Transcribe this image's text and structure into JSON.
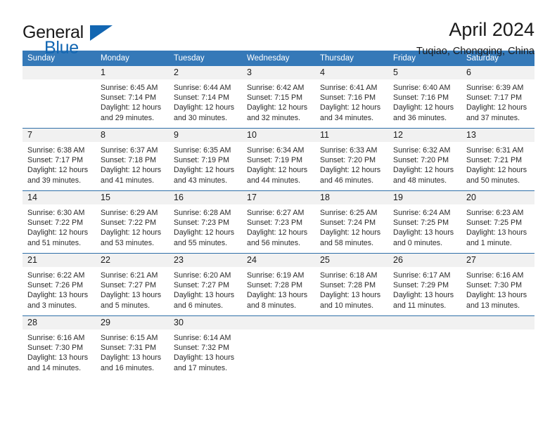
{
  "brand": {
    "name_top": "General",
    "name_bottom": "Blue",
    "accent_color": "#1266b2"
  },
  "header": {
    "title": "April 2024",
    "subtitle": "Tuqiao, Chongqing, China"
  },
  "calendar": {
    "header_bg": "#3579b8",
    "daynum_bg": "#f1f1f1",
    "row_divider_color": "#2f6fa8",
    "weekday_headers": [
      "Sunday",
      "Monday",
      "Tuesday",
      "Wednesday",
      "Thursday",
      "Friday",
      "Saturday"
    ],
    "weeks": [
      [
        {
          "day": "",
          "sunrise": "",
          "sunset": "",
          "daylight_line1": "",
          "daylight_line2": ""
        },
        {
          "day": "1",
          "sunrise": "Sunrise: 6:45 AM",
          "sunset": "Sunset: 7:14 PM",
          "daylight_line1": "Daylight: 12 hours",
          "daylight_line2": "and 29 minutes."
        },
        {
          "day": "2",
          "sunrise": "Sunrise: 6:44 AM",
          "sunset": "Sunset: 7:14 PM",
          "daylight_line1": "Daylight: 12 hours",
          "daylight_line2": "and 30 minutes."
        },
        {
          "day": "3",
          "sunrise": "Sunrise: 6:42 AM",
          "sunset": "Sunset: 7:15 PM",
          "daylight_line1": "Daylight: 12 hours",
          "daylight_line2": "and 32 minutes."
        },
        {
          "day": "4",
          "sunrise": "Sunrise: 6:41 AM",
          "sunset": "Sunset: 7:16 PM",
          "daylight_line1": "Daylight: 12 hours",
          "daylight_line2": "and 34 minutes."
        },
        {
          "day": "5",
          "sunrise": "Sunrise: 6:40 AM",
          "sunset": "Sunset: 7:16 PM",
          "daylight_line1": "Daylight: 12 hours",
          "daylight_line2": "and 36 minutes."
        },
        {
          "day": "6",
          "sunrise": "Sunrise: 6:39 AM",
          "sunset": "Sunset: 7:17 PM",
          "daylight_line1": "Daylight: 12 hours",
          "daylight_line2": "and 37 minutes."
        }
      ],
      [
        {
          "day": "7",
          "sunrise": "Sunrise: 6:38 AM",
          "sunset": "Sunset: 7:17 PM",
          "daylight_line1": "Daylight: 12 hours",
          "daylight_line2": "and 39 minutes."
        },
        {
          "day": "8",
          "sunrise": "Sunrise: 6:37 AM",
          "sunset": "Sunset: 7:18 PM",
          "daylight_line1": "Daylight: 12 hours",
          "daylight_line2": "and 41 minutes."
        },
        {
          "day": "9",
          "sunrise": "Sunrise: 6:35 AM",
          "sunset": "Sunset: 7:19 PM",
          "daylight_line1": "Daylight: 12 hours",
          "daylight_line2": "and 43 minutes."
        },
        {
          "day": "10",
          "sunrise": "Sunrise: 6:34 AM",
          "sunset": "Sunset: 7:19 PM",
          "daylight_line1": "Daylight: 12 hours",
          "daylight_line2": "and 44 minutes."
        },
        {
          "day": "11",
          "sunrise": "Sunrise: 6:33 AM",
          "sunset": "Sunset: 7:20 PM",
          "daylight_line1": "Daylight: 12 hours",
          "daylight_line2": "and 46 minutes."
        },
        {
          "day": "12",
          "sunrise": "Sunrise: 6:32 AM",
          "sunset": "Sunset: 7:20 PM",
          "daylight_line1": "Daylight: 12 hours",
          "daylight_line2": "and 48 minutes."
        },
        {
          "day": "13",
          "sunrise": "Sunrise: 6:31 AM",
          "sunset": "Sunset: 7:21 PM",
          "daylight_line1": "Daylight: 12 hours",
          "daylight_line2": "and 50 minutes."
        }
      ],
      [
        {
          "day": "14",
          "sunrise": "Sunrise: 6:30 AM",
          "sunset": "Sunset: 7:22 PM",
          "daylight_line1": "Daylight: 12 hours",
          "daylight_line2": "and 51 minutes."
        },
        {
          "day": "15",
          "sunrise": "Sunrise: 6:29 AM",
          "sunset": "Sunset: 7:22 PM",
          "daylight_line1": "Daylight: 12 hours",
          "daylight_line2": "and 53 minutes."
        },
        {
          "day": "16",
          "sunrise": "Sunrise: 6:28 AM",
          "sunset": "Sunset: 7:23 PM",
          "daylight_line1": "Daylight: 12 hours",
          "daylight_line2": "and 55 minutes."
        },
        {
          "day": "17",
          "sunrise": "Sunrise: 6:27 AM",
          "sunset": "Sunset: 7:23 PM",
          "daylight_line1": "Daylight: 12 hours",
          "daylight_line2": "and 56 minutes."
        },
        {
          "day": "18",
          "sunrise": "Sunrise: 6:25 AM",
          "sunset": "Sunset: 7:24 PM",
          "daylight_line1": "Daylight: 12 hours",
          "daylight_line2": "and 58 minutes."
        },
        {
          "day": "19",
          "sunrise": "Sunrise: 6:24 AM",
          "sunset": "Sunset: 7:25 PM",
          "daylight_line1": "Daylight: 13 hours",
          "daylight_line2": "and 0 minutes."
        },
        {
          "day": "20",
          "sunrise": "Sunrise: 6:23 AM",
          "sunset": "Sunset: 7:25 PM",
          "daylight_line1": "Daylight: 13 hours",
          "daylight_line2": "and 1 minute."
        }
      ],
      [
        {
          "day": "21",
          "sunrise": "Sunrise: 6:22 AM",
          "sunset": "Sunset: 7:26 PM",
          "daylight_line1": "Daylight: 13 hours",
          "daylight_line2": "and 3 minutes."
        },
        {
          "day": "22",
          "sunrise": "Sunrise: 6:21 AM",
          "sunset": "Sunset: 7:27 PM",
          "daylight_line1": "Daylight: 13 hours",
          "daylight_line2": "and 5 minutes."
        },
        {
          "day": "23",
          "sunrise": "Sunrise: 6:20 AM",
          "sunset": "Sunset: 7:27 PM",
          "daylight_line1": "Daylight: 13 hours",
          "daylight_line2": "and 6 minutes."
        },
        {
          "day": "24",
          "sunrise": "Sunrise: 6:19 AM",
          "sunset": "Sunset: 7:28 PM",
          "daylight_line1": "Daylight: 13 hours",
          "daylight_line2": "and 8 minutes."
        },
        {
          "day": "25",
          "sunrise": "Sunrise: 6:18 AM",
          "sunset": "Sunset: 7:28 PM",
          "daylight_line1": "Daylight: 13 hours",
          "daylight_line2": "and 10 minutes."
        },
        {
          "day": "26",
          "sunrise": "Sunrise: 6:17 AM",
          "sunset": "Sunset: 7:29 PM",
          "daylight_line1": "Daylight: 13 hours",
          "daylight_line2": "and 11 minutes."
        },
        {
          "day": "27",
          "sunrise": "Sunrise: 6:16 AM",
          "sunset": "Sunset: 7:30 PM",
          "daylight_line1": "Daylight: 13 hours",
          "daylight_line2": "and 13 minutes."
        }
      ],
      [
        {
          "day": "28",
          "sunrise": "Sunrise: 6:16 AM",
          "sunset": "Sunset: 7:30 PM",
          "daylight_line1": "Daylight: 13 hours",
          "daylight_line2": "and 14 minutes."
        },
        {
          "day": "29",
          "sunrise": "Sunrise: 6:15 AM",
          "sunset": "Sunset: 7:31 PM",
          "daylight_line1": "Daylight: 13 hours",
          "daylight_line2": "and 16 minutes."
        },
        {
          "day": "30",
          "sunrise": "Sunrise: 6:14 AM",
          "sunset": "Sunset: 7:32 PM",
          "daylight_line1": "Daylight: 13 hours",
          "daylight_line2": "and 17 minutes."
        },
        {
          "day": "",
          "sunrise": "",
          "sunset": "",
          "daylight_line1": "",
          "daylight_line2": ""
        },
        {
          "day": "",
          "sunrise": "",
          "sunset": "",
          "daylight_line1": "",
          "daylight_line2": ""
        },
        {
          "day": "",
          "sunrise": "",
          "sunset": "",
          "daylight_line1": "",
          "daylight_line2": ""
        },
        {
          "day": "",
          "sunrise": "",
          "sunset": "",
          "daylight_line1": "",
          "daylight_line2": ""
        }
      ]
    ]
  }
}
